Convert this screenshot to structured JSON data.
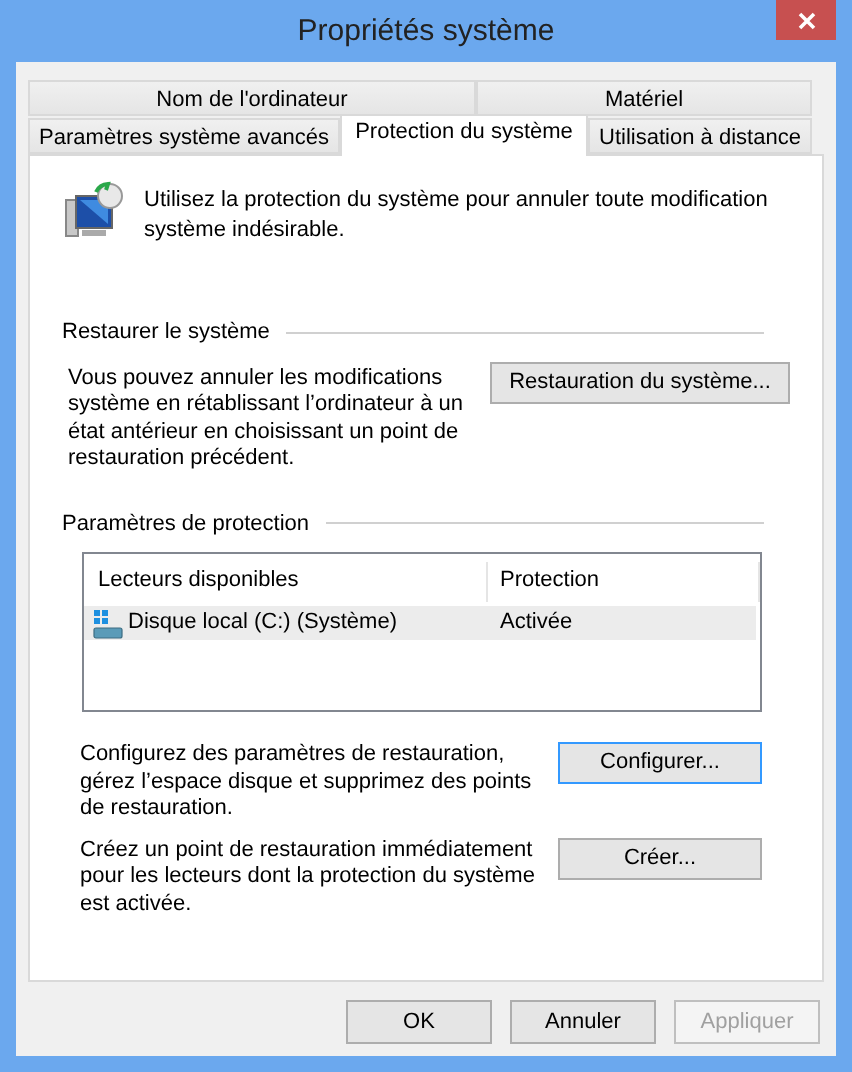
{
  "window": {
    "title": "Propriétés système"
  },
  "tab_rows": [
    [
      {
        "label": "Nom de l'ordinateur",
        "selected": false
      },
      {
        "label": "Matériel",
        "selected": false
      }
    ],
    [
      {
        "label": "Paramètres système avancés",
        "selected": false
      },
      {
        "label": "Protection du système",
        "selected": true
      },
      {
        "label": "Utilisation à distance",
        "selected": false
      }
    ]
  ],
  "intro": "Utilisez la protection du système pour annuler toute modification système indésirable.",
  "restore": {
    "title": "Restaurer le système",
    "text": "Vous pouvez annuler les modifications système en rétablissant l’ordinateur à un état antérieur en choisissant un point de restauration précédent.",
    "button": "Restauration du système..."
  },
  "protection": {
    "title": "Paramètres de protection",
    "columns": [
      "Lecteurs disponibles",
      "Protection"
    ],
    "rows": [
      {
        "drive": "Disque local (C:) (Système)",
        "protection": "Activée",
        "selected": true
      }
    ],
    "actions": [
      {
        "text": "Configurez des paramètres de restauration, gérez l’espace disque et supprimez des points de restauration.",
        "button": "Configurer...",
        "focused": true
      },
      {
        "text": "Créez un point de restauration immédiatement pour les lecteurs dont la protection du système est activée.",
        "button": "Créer...",
        "focused": false
      }
    ]
  },
  "buttons": [
    {
      "label": "OK",
      "disabled": false
    },
    {
      "label": "Annuler",
      "disabled": false
    },
    {
      "label": "Appliquer",
      "disabled": true
    }
  ]
}
